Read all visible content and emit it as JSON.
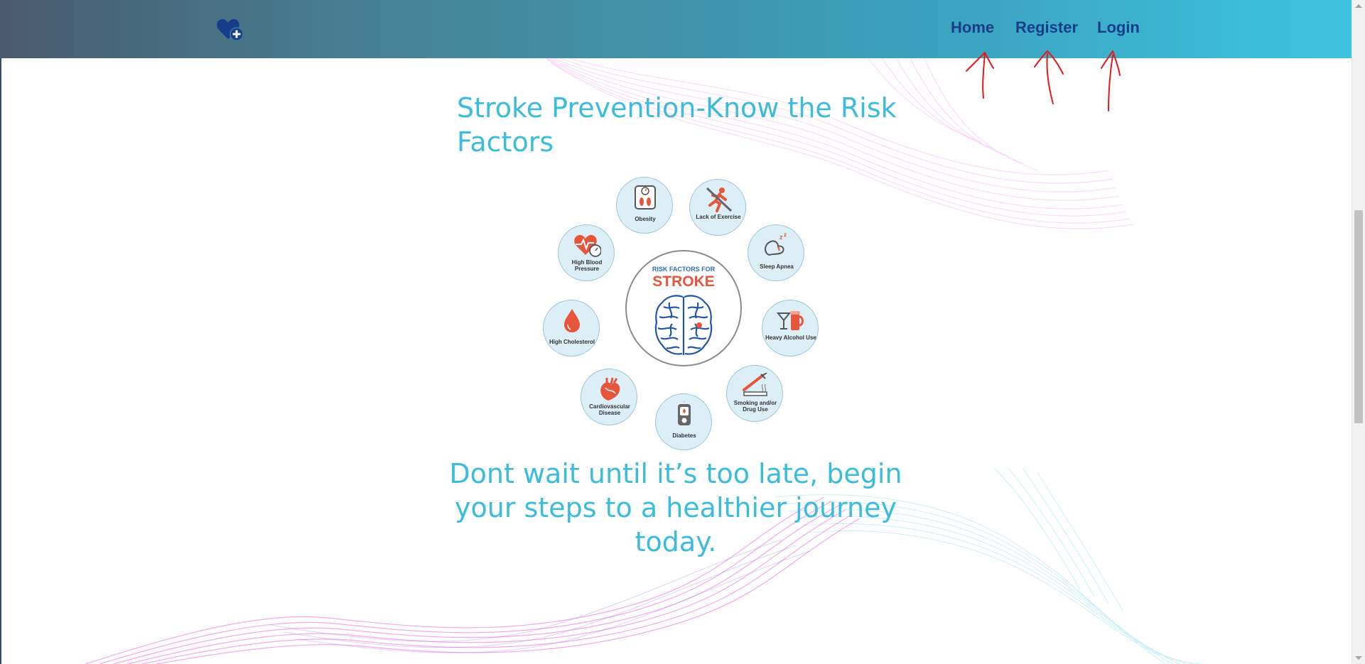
{
  "nav": {
    "logo_icon": "heart-plus-icon",
    "links": [
      "Home",
      "Register",
      "Login"
    ]
  },
  "colors": {
    "accent": "#3cbcdb",
    "nav_link": "#163d8a",
    "annotation": "#e01b1b",
    "risk_red": "#e8553d"
  },
  "main": {
    "title": "Stroke Prevention-Know the Risk Factors",
    "tagline": "Dont wait until it’s too late, begin your steps to a healthier journey today."
  },
  "infographic": {
    "header_small": "RISK FACTORS FOR",
    "header_big": "STROKE",
    "factors": [
      {
        "label": "Obesity",
        "icon": "scale-icon"
      },
      {
        "label": "Lack of Exercise",
        "icon": "running-icon"
      },
      {
        "label": "Sleep Apnea",
        "icon": "sleep-icon"
      },
      {
        "label": "Heavy Alcohol Use",
        "icon": "alcohol-icon"
      },
      {
        "label": "Smoking and/or Drug Use",
        "icon": "syringe-cigarette-icon"
      },
      {
        "label": "Diabetes",
        "icon": "glucose-meter-icon"
      },
      {
        "label": "Cardiovascular Disease",
        "icon": "heart-organ-icon"
      },
      {
        "label": "High Cholesterol",
        "icon": "drop-icon"
      },
      {
        "label": "High Blood Pressure",
        "icon": "heart-pulse-icon"
      }
    ]
  },
  "annotations": {
    "marks": [
      "arrow-home",
      "arrow-register",
      "arrow-login"
    ]
  }
}
